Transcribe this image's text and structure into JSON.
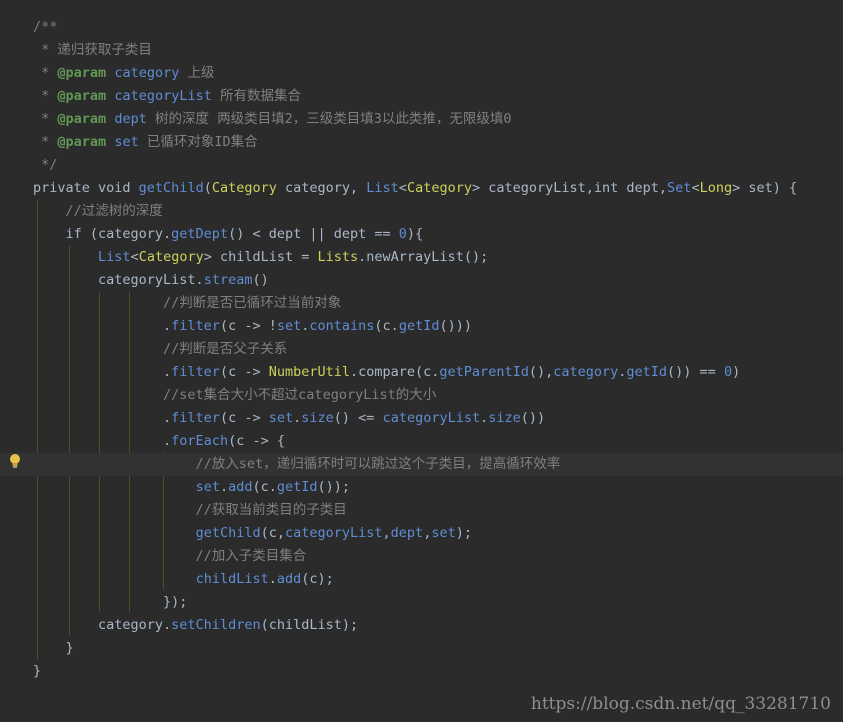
{
  "watermark": "https://blog.csdn.net/qq_33281710",
  "icons": {
    "gutter": "lightbulb-icon"
  },
  "lines": [
    {
      "t": [
        [
          "/**",
          "c-comment"
        ]
      ]
    },
    {
      "t": [
        [
          " * 递归获取子类目",
          "c-comment"
        ]
      ]
    },
    {
      "t": [
        [
          " * ",
          "c-comment"
        ],
        [
          "@param",
          "c-tag"
        ],
        [
          " ",
          "c-comment"
        ],
        [
          "category",
          "c-method"
        ],
        [
          " 上级",
          "c-comment"
        ]
      ]
    },
    {
      "t": [
        [
          " * ",
          "c-comment"
        ],
        [
          "@param",
          "c-tag"
        ],
        [
          " ",
          "c-comment"
        ],
        [
          "categoryList",
          "c-method"
        ],
        [
          " 所有数据集合",
          "c-comment"
        ]
      ]
    },
    {
      "t": [
        [
          " * ",
          "c-comment"
        ],
        [
          "@param",
          "c-tag"
        ],
        [
          " ",
          "c-comment"
        ],
        [
          "dept",
          "c-method"
        ],
        [
          " 树的深度 两级类目填2，三级类目填3以此类推，无限级填0",
          "c-comment"
        ]
      ]
    },
    {
      "t": [
        [
          " * ",
          "c-comment"
        ],
        [
          "@param",
          "c-tag"
        ],
        [
          " ",
          "c-comment"
        ],
        [
          "set",
          "c-method"
        ],
        [
          " 已循环对象ID集合",
          "c-comment"
        ]
      ]
    },
    {
      "t": [
        [
          " */",
          "c-comment"
        ]
      ]
    },
    {
      "t": [
        [
          "private void ",
          "c-plain"
        ],
        [
          "getChild",
          "c-method"
        ],
        [
          "(",
          "c-plain"
        ],
        [
          "Category",
          "c-yellow"
        ],
        [
          " category, ",
          "c-plain"
        ],
        [
          "List",
          "c-method"
        ],
        [
          "<",
          "c-plain"
        ],
        [
          "Category",
          "c-yellow"
        ],
        [
          "> categoryList,int dept,",
          "c-plain"
        ],
        [
          "Set",
          "c-method"
        ],
        [
          "<",
          "c-plain"
        ],
        [
          "Long",
          "c-yellow"
        ],
        [
          "> set) {",
          "c-plain"
        ]
      ]
    },
    {
      "t": [
        [
          "    //过滤树的深度",
          "c-comment"
        ]
      ]
    },
    {
      "t": [
        [
          "    if (category.",
          "c-plain"
        ],
        [
          "getDept",
          "c-method"
        ],
        [
          "() < dept || dept == ",
          "c-plain"
        ],
        [
          "0",
          "c-method"
        ],
        [
          "){",
          "c-plain"
        ]
      ]
    },
    {
      "t": [
        [
          "        ",
          "c-plain"
        ],
        [
          "List",
          "c-method"
        ],
        [
          "<",
          "c-plain"
        ],
        [
          "Category",
          "c-yellow"
        ],
        [
          "> childList = ",
          "c-plain"
        ],
        [
          "Lists",
          "c-yellow"
        ],
        [
          ".newArrayList();",
          "c-plain"
        ]
      ]
    },
    {
      "t": [
        [
          "        categoryList.",
          "c-plain"
        ],
        [
          "stream",
          "c-method"
        ],
        [
          "()",
          "c-plain"
        ]
      ]
    },
    {
      "t": [
        [
          "                //判断是否已循环过当前对象",
          "c-comment"
        ]
      ]
    },
    {
      "t": [
        [
          "                .",
          "c-plain"
        ],
        [
          "filter",
          "c-method"
        ],
        [
          "(c -> !",
          "c-plain"
        ],
        [
          "set",
          "c-method"
        ],
        [
          ".",
          "c-plain"
        ],
        [
          "contains",
          "c-method"
        ],
        [
          "(c.",
          "c-plain"
        ],
        [
          "getId",
          "c-method"
        ],
        [
          "()))",
          "c-plain"
        ]
      ]
    },
    {
      "t": [
        [
          "                //判断是否父子关系",
          "c-comment"
        ]
      ]
    },
    {
      "t": [
        [
          "                .",
          "c-plain"
        ],
        [
          "filter",
          "c-method"
        ],
        [
          "(c -> ",
          "c-plain"
        ],
        [
          "NumberUtil",
          "c-yellow"
        ],
        [
          ".compare(c.",
          "c-plain"
        ],
        [
          "getParentId",
          "c-method"
        ],
        [
          "(),",
          "c-plain"
        ],
        [
          "category",
          "c-method"
        ],
        [
          ".",
          "c-plain"
        ],
        [
          "getId",
          "c-method"
        ],
        [
          "()) == ",
          "c-plain"
        ],
        [
          "0",
          "c-method"
        ],
        [
          ")",
          "c-plain"
        ]
      ]
    },
    {
      "t": [
        [
          "                //set集合大小不超过categoryList的大小",
          "c-comment"
        ]
      ]
    },
    {
      "t": [
        [
          "                .",
          "c-plain"
        ],
        [
          "filter",
          "c-method"
        ],
        [
          "(c -> ",
          "c-plain"
        ],
        [
          "set",
          "c-method"
        ],
        [
          ".",
          "c-plain"
        ],
        [
          "size",
          "c-method"
        ],
        [
          "() <= ",
          "c-plain"
        ],
        [
          "categoryList",
          "c-method"
        ],
        [
          ".",
          "c-plain"
        ],
        [
          "size",
          "c-method"
        ],
        [
          "())",
          "c-plain"
        ]
      ]
    },
    {
      "t": [
        [
          "                .",
          "c-plain"
        ],
        [
          "forEach",
          "c-method"
        ],
        [
          "(c -> {",
          "c-plain"
        ]
      ]
    },
    {
      "t": [
        [
          "                    //放入set，递归循环时可以跳过这个子类目，提高循环效率",
          "c-comment"
        ]
      ],
      "hl": true
    },
    {
      "t": [
        [
          "                    ",
          "c-plain"
        ],
        [
          "set",
          "c-method"
        ],
        [
          ".",
          "c-plain"
        ],
        [
          "add",
          "c-method"
        ],
        [
          "(c.",
          "c-plain"
        ],
        [
          "getId",
          "c-method"
        ],
        [
          "());",
          "c-plain"
        ]
      ]
    },
    {
      "t": [
        [
          "                    //获取当前类目的子类目",
          "c-comment"
        ]
      ]
    },
    {
      "t": [
        [
          "                    ",
          "c-plain"
        ],
        [
          "getChild",
          "c-method"
        ],
        [
          "(c,",
          "c-plain"
        ],
        [
          "categoryList",
          "c-method"
        ],
        [
          ",",
          "c-plain"
        ],
        [
          "dept",
          "c-method"
        ],
        [
          ",",
          "c-plain"
        ],
        [
          "set",
          "c-method"
        ],
        [
          ");",
          "c-plain"
        ]
      ]
    },
    {
      "t": [
        [
          "                    //加入子类目集合",
          "c-comment"
        ]
      ]
    },
    {
      "t": [
        [
          "                    ",
          "c-plain"
        ],
        [
          "childList",
          "c-method"
        ],
        [
          ".",
          "c-plain"
        ],
        [
          "add",
          "c-method"
        ],
        [
          "(c);",
          "c-plain"
        ]
      ]
    },
    {
      "t": [
        [
          "                });",
          "c-plain"
        ]
      ]
    },
    {
      "t": [
        [
          "        category.",
          "c-plain"
        ],
        [
          "setChildren",
          "c-method"
        ],
        [
          "(childList);",
          "c-plain"
        ]
      ]
    },
    {
      "t": [
        [
          "    }",
          "c-plain"
        ]
      ]
    },
    {
      "t": [
        [
          "}",
          "c-plain"
        ]
      ]
    }
  ]
}
